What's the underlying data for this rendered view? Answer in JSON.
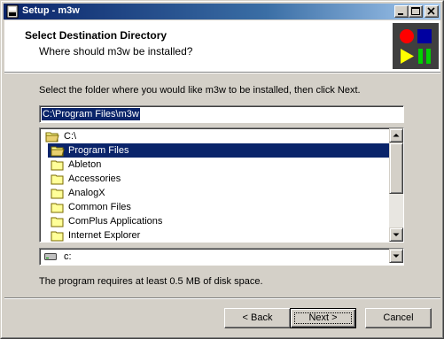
{
  "window": {
    "title": "Setup - m3w"
  },
  "header": {
    "title": "Select Destination Directory",
    "subtitle": "Where should m3w be installed?"
  },
  "instruction": "Select the folder where you would like m3w to be installed, then click Next.",
  "path_field": {
    "value": "C:\\Program Files\\m3w"
  },
  "folder_tree": {
    "root": "C:\\",
    "selected": "Program Files",
    "children": [
      "Ableton",
      "Accessories",
      "AnalogX",
      "Common Files",
      "ComPlus Applications",
      "Internet Explorer"
    ]
  },
  "drive": {
    "label": "c:"
  },
  "space_requirement": "The program requires at least 0.5 MB of disk space.",
  "buttons": {
    "back": "< Back",
    "next": "Next >",
    "cancel": "Cancel"
  },
  "colors": {
    "titlebar_start": "#0a246a",
    "titlebar_end": "#a6caf0",
    "selection": "#0a246a",
    "face": "#d4d0c8"
  }
}
